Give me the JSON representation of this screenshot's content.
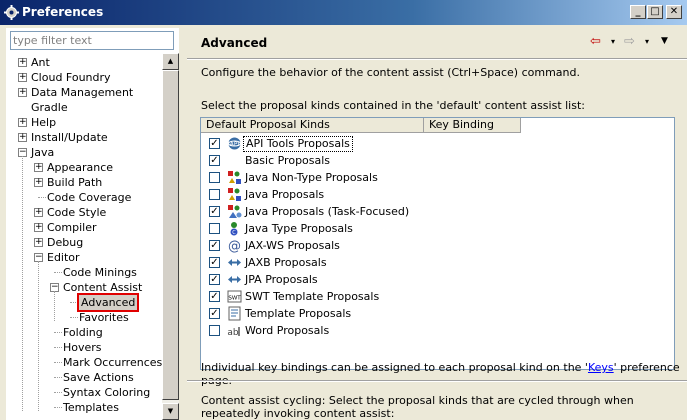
{
  "window": {
    "title": "Preferences",
    "min": "_",
    "max": "□",
    "close": "✕"
  },
  "filter": {
    "placeholder": "type filter text"
  },
  "tree": [
    {
      "label": "Ant",
      "exp": "+"
    },
    {
      "label": "Cloud Foundry",
      "exp": "+"
    },
    {
      "label": "Data Management",
      "exp": "+"
    },
    {
      "label": "Gradle",
      "exp": ""
    },
    {
      "label": "Help",
      "exp": "+"
    },
    {
      "label": "Install/Update",
      "exp": "+"
    },
    {
      "label": "Java",
      "exp": "−"
    },
    {
      "label": "Appearance",
      "exp": "+"
    },
    {
      "label": "Build Path",
      "exp": "+"
    },
    {
      "label": "Code Coverage",
      "exp": ""
    },
    {
      "label": "Code Style",
      "exp": "+"
    },
    {
      "label": "Compiler",
      "exp": "+"
    },
    {
      "label": "Debug",
      "exp": "+"
    },
    {
      "label": "Editor",
      "exp": "−"
    },
    {
      "label": "Code Minings",
      "exp": ""
    },
    {
      "label": "Content Assist",
      "exp": "−"
    },
    {
      "label": "Advanced",
      "exp": "",
      "selected": true
    },
    {
      "label": "Favorites",
      "exp": ""
    },
    {
      "label": "Folding",
      "exp": ""
    },
    {
      "label": "Hovers",
      "exp": ""
    },
    {
      "label": "Mark Occurrences",
      "exp": ""
    },
    {
      "label": "Save Actions",
      "exp": ""
    },
    {
      "label": "Syntax Coloring",
      "exp": ""
    },
    {
      "label": "Templates",
      "exp": ""
    }
  ],
  "page": {
    "title": "Advanced",
    "nav_back": "⇦",
    "nav_forward": "⇨",
    "nav_dropdown": "▾",
    "nav_menu": "▼",
    "description": "Configure the behavior of the content assist (Ctrl+Space) command.",
    "select_label": "Select the proposal kinds contained in the 'default' content assist list:",
    "columns": [
      "Default Proposal Kinds",
      "Key Binding"
    ],
    "proposals": [
      {
        "label": "API Tools Proposals",
        "checked": true,
        "icon": "api-tools-icon",
        "highlighted": true
      },
      {
        "label": "Basic Proposals",
        "checked": true,
        "icon": "none"
      },
      {
        "label": "Java Non-Type Proposals",
        "checked": false,
        "icon": "java-members-icon"
      },
      {
        "label": "Java Proposals",
        "checked": false,
        "icon": "java-members-icon"
      },
      {
        "label": "Java Proposals (Task-Focused)",
        "checked": true,
        "icon": "java-task-icon"
      },
      {
        "label": "Java Type Proposals",
        "checked": false,
        "icon": "java-type-icon"
      },
      {
        "label": "JAX-WS Proposals",
        "checked": true,
        "icon": "at-sign-icon"
      },
      {
        "label": "JAXB Proposals",
        "checked": true,
        "icon": "arrows-icon"
      },
      {
        "label": "JPA Proposals",
        "checked": true,
        "icon": "arrows-icon"
      },
      {
        "label": "SWT Template Proposals",
        "checked": true,
        "icon": "swt-icon"
      },
      {
        "label": "Template Proposals",
        "checked": true,
        "icon": "template-icon"
      },
      {
        "label": "Word Proposals",
        "checked": false,
        "icon": "word-icon"
      }
    ],
    "info_prefix": "Individual key bindings can be assigned to each proposal kind on the '",
    "info_link": "Keys",
    "info_suffix": "' preference page.",
    "cycling_text": "Content assist cycling: Select the proposal kinds that are cycled through when repeatedly invoking content assist:"
  },
  "colors": {
    "title_bar": "#0a246a",
    "selection_outline": "#e00000",
    "link": "#0000ff"
  }
}
